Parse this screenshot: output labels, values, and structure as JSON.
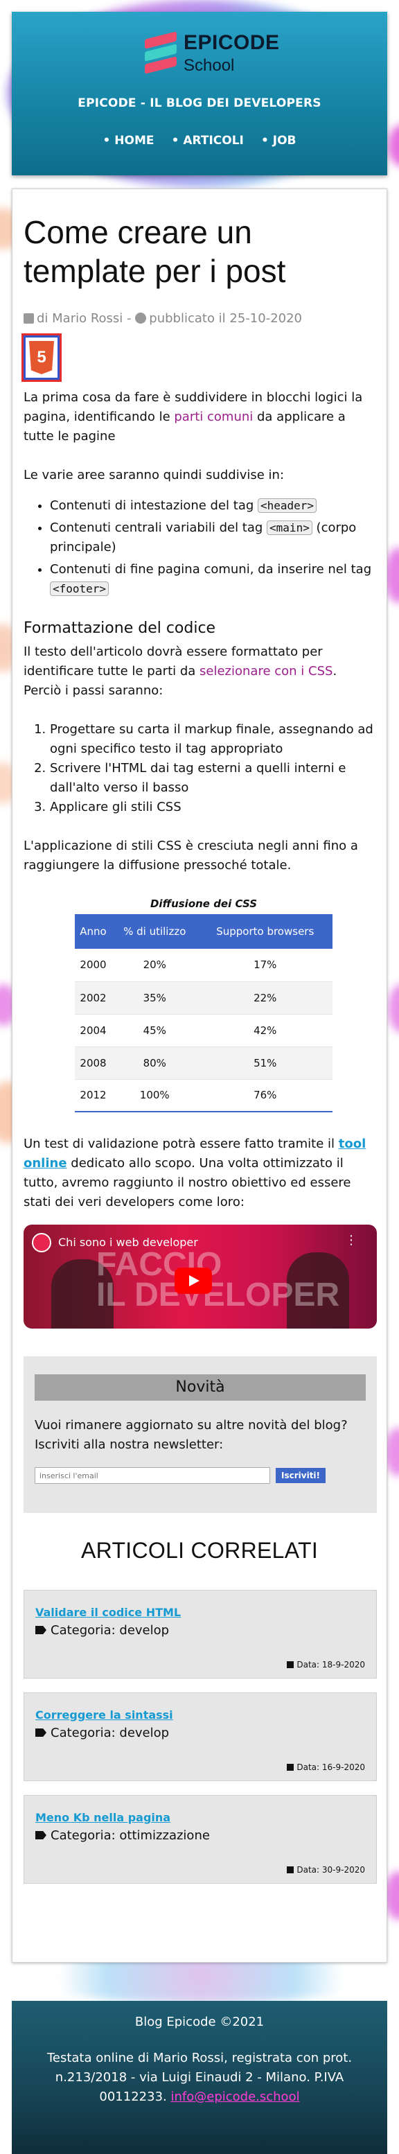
{
  "header": {
    "logo_line1": "EPICODE",
    "logo_line2": "School",
    "tagline": "EPICODE - IL BLOG DEI DEVELOPERS",
    "nav": [
      "HOME",
      "ARTICOLI",
      "JOB"
    ]
  },
  "article": {
    "title": "Come creare un template per i post",
    "meta_author": "di Mario Rossi - ",
    "meta_published": "pubblicato il 25-10-2020",
    "html5_badge": "5",
    "p1_before": "La prima cosa da fare è suddividere in blocchi logici la pagina, identificando le ",
    "p1_highlight": "parti comuni",
    "p1_after": " da applicare a tutte le pagine",
    "p2": "Le varie aree saranno quindi suddivise in:",
    "list1": [
      {
        "text": "Contenuti di intestazione del tag ",
        "code": "<header>",
        "after": ""
      },
      {
        "text": "Contenuti centrali variabili del tag ",
        "code": "<main>",
        "after": " (corpo principale)"
      },
      {
        "text": "Contenuti di fine pagina comuni, da inserire nel tag ",
        "code": "<footer>",
        "after": ""
      }
    ],
    "subheading": "Formattazione del codice",
    "p3_before": "Il testo dell'articolo dovrà essere formattato per identificare tutte le parti da ",
    "p3_highlight": "selezionare con i CSS",
    "p3_after": ". Perciò i passi saranno:",
    "list2": [
      "Progettare su carta il markup finale, assegnando ad ogni specifico testo il tag appropriato",
      "Scrivere l'HTML dai tag esterni a quelli interni e dall'alto verso il basso",
      "Applicare gli stili CSS"
    ],
    "p4": "L'applicazione di stili CSS è cresciuta negli anni fino a raggiungere la diffusione pressoché totale.",
    "table": {
      "caption": "Diffusione dei CSS",
      "headers": [
        "Anno",
        "% di utilizzo",
        "Supporto browsers"
      ],
      "rows": [
        [
          "2000",
          "20%",
          "17%"
        ],
        [
          "2002",
          "35%",
          "22%"
        ],
        [
          "2004",
          "45%",
          "42%"
        ],
        [
          "2008",
          "80%",
          "51%"
        ],
        [
          "2012",
          "100%",
          "76%"
        ]
      ]
    },
    "p5_before": "Un test di validazione potrà essere fatto tramite il ",
    "p5_link": "tool online",
    "p5_after": " dedicato allo scopo. Una volta ottimizzato il tutto, avremo raggiunto il nostro obiettivo ed essere stati dei veri developers come loro:",
    "video": {
      "title": "Chi sono i web developer",
      "overlay_line1": "FACCIO",
      "overlay_line2": "IL DEVELOPER",
      "menu": "⋮"
    }
  },
  "newsletter": {
    "title": "Novità",
    "text": "Vuoi rimanere aggiornato su altre novità del blog? Iscriviti alla nostra newsletter:",
    "placeholder": "inserisci l'email",
    "button": "Iscriviti!"
  },
  "related": {
    "title": "ARTICOLI CORRELATI",
    "cards": [
      {
        "link": "Validare il codice HTML",
        "category": "Categoria: develop",
        "date": "Data: 18-9-2020"
      },
      {
        "link": "Correggere la sintassi",
        "category": "Categoria: develop",
        "date": "Data: 16-9-2020"
      },
      {
        "link": "Meno Kb nella pagina",
        "category": "Categoria: ottimizzazione",
        "date": "Data: 30-9-2020"
      }
    ]
  },
  "footer": {
    "line1": "Blog Epicode ©2021",
    "line2": "Testata online di Mario Rossi, registrata con prot. n.213/2018 - via Luigi Einaudi 2 - Milano. P.IVA 00112233.",
    "email": "info@epicode.school"
  },
  "colors": {
    "accent_purple": "#9c1f8c",
    "link_blue": "#169ad2",
    "table_header": "#3c67c8",
    "footer_email": "#ff3bd8"
  }
}
